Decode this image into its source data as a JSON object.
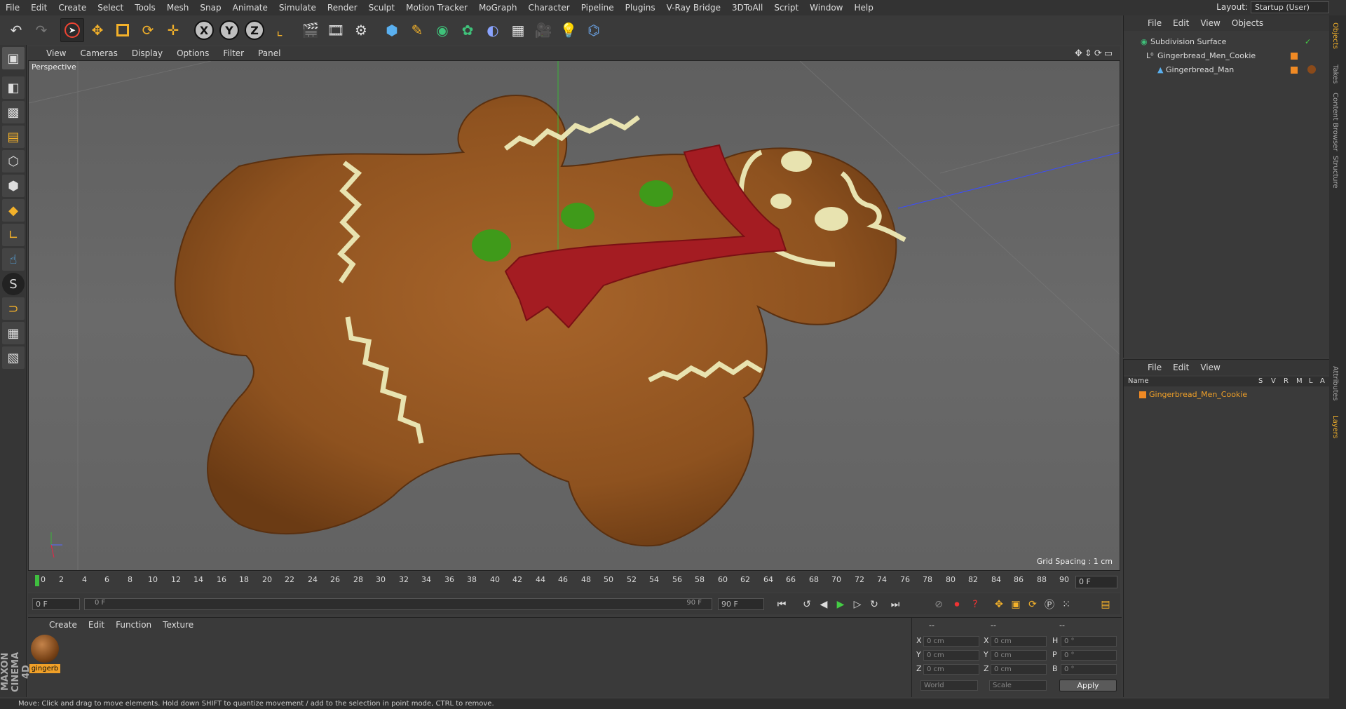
{
  "menubar": {
    "items": [
      "File",
      "Edit",
      "Create",
      "Select",
      "Tools",
      "Mesh",
      "Snap",
      "Animate",
      "Simulate",
      "Render",
      "Sculpt",
      "Motion Tracker",
      "MoGraph",
      "Character",
      "Pipeline",
      "Plugins",
      "V-Ray Bridge",
      "3DToAll",
      "Script",
      "Window",
      "Help"
    ],
    "layout_label": "Layout:",
    "layout_value": "Startup (User)"
  },
  "toolbar": {
    "x_label": "X",
    "y_label": "Y",
    "z_label": "Z"
  },
  "viewport": {
    "menu": [
      "View",
      "Cameras",
      "Display",
      "Options",
      "Filter",
      "Panel"
    ],
    "label": "Perspective",
    "grid_spacing": "Grid Spacing : 1 cm"
  },
  "timeline": {
    "ticks": [
      "0",
      "2",
      "4",
      "6",
      "8",
      "10",
      "12",
      "14",
      "16",
      "18",
      "20",
      "22",
      "24",
      "26",
      "28",
      "30",
      "32",
      "34",
      "36",
      "38",
      "40",
      "42",
      "44",
      "46",
      "48",
      "50",
      "52",
      "54",
      "56",
      "58",
      "60",
      "62",
      "64",
      "66",
      "68",
      "70",
      "72",
      "74",
      "76",
      "78",
      "80",
      "82",
      "84",
      "86",
      "88",
      "90"
    ],
    "current_frame": "0 F"
  },
  "transport": {
    "start": "0 F",
    "slider_start": "0 F",
    "slider_end": "90 F",
    "end": "90 F"
  },
  "materials": {
    "menu": [
      "Create",
      "Edit",
      "Function",
      "Texture"
    ],
    "material_name": "gingerb"
  },
  "coords": {
    "header1": "--",
    "header2": "--",
    "header3": "--",
    "x_pos": "0 cm",
    "y_pos": "0 cm",
    "z_pos": "0 cm",
    "x_size": "0 cm",
    "y_size": "0 cm",
    "z_size": "0 cm",
    "h_rot": "0 °",
    "p_rot": "0 °",
    "b_rot": "0 °",
    "world": "World",
    "scale": "Scale",
    "apply": "Apply"
  },
  "object_manager": {
    "menu": [
      "File",
      "Edit",
      "View",
      "Objects"
    ],
    "objects": [
      "Subdivision Surface",
      "Gingerbread_Men_Cookie",
      "Gingerbread_Man"
    ]
  },
  "layer_manager": {
    "menu": [
      "File",
      "Edit",
      "View"
    ],
    "name_header": "Name",
    "cols": [
      "S",
      "V",
      "R",
      "M",
      "L",
      "A"
    ],
    "layer": "Gingerbread_Men_Cookie"
  },
  "side_tabs": [
    "Objects",
    "Takes",
    "Content Browser",
    "Structure",
    "Attributes",
    "Layers"
  ],
  "status": "Move: Click and drag to move elements. Hold down SHIFT to quantize movement / add to the selection in point mode, CTRL to remove.",
  "brand": "MAXON CINEMA 4D",
  "colors": {
    "cookie": "#9a5a25",
    "icing": "#e8e3b0",
    "scarf": "#a41c22",
    "button": "#3f9a1a",
    "layer_orange": "#f08a24"
  }
}
